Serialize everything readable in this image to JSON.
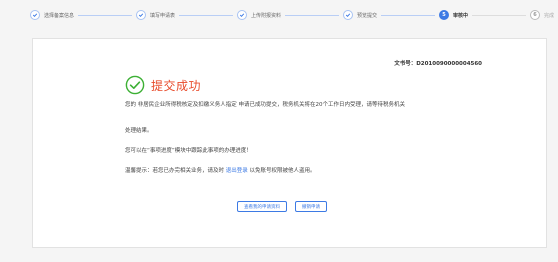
{
  "steps": [
    {
      "label": "选择备案信息",
      "status": "done"
    },
    {
      "label": "填写申请表",
      "status": "done"
    },
    {
      "label": "上传附报资料",
      "status": "done"
    },
    {
      "label": "预览提交",
      "status": "done"
    },
    {
      "label": "审核中",
      "number": "5",
      "status": "active"
    },
    {
      "label": "完成",
      "number": "6",
      "status": "todo"
    }
  ],
  "doc_number_label": "文书号：D2010090000004560",
  "success_title": "提交成功",
  "message_line1": "您的 非居民企业所得税核定及扣缴义务人指定 申请已成功提交，税务机关将在20个工作日内受理，请等待税务机关",
  "message_line2": "处理结果。",
  "message_progress": "您可以在“事项进度”模块中跟踪此事项的办理进度！",
  "reminder": {
    "prefix": "温馨提示：若您已办完相关业务，请及时 ",
    "link": "退出登录",
    "suffix": " 以免账号权限被他人盗用。"
  },
  "buttons": {
    "view_request": "查看我的申请资料",
    "revoke": "撤销申请"
  },
  "colors": {
    "accent": "#3d7ae4",
    "success": "#3cb034",
    "title": "#e84a2a"
  }
}
